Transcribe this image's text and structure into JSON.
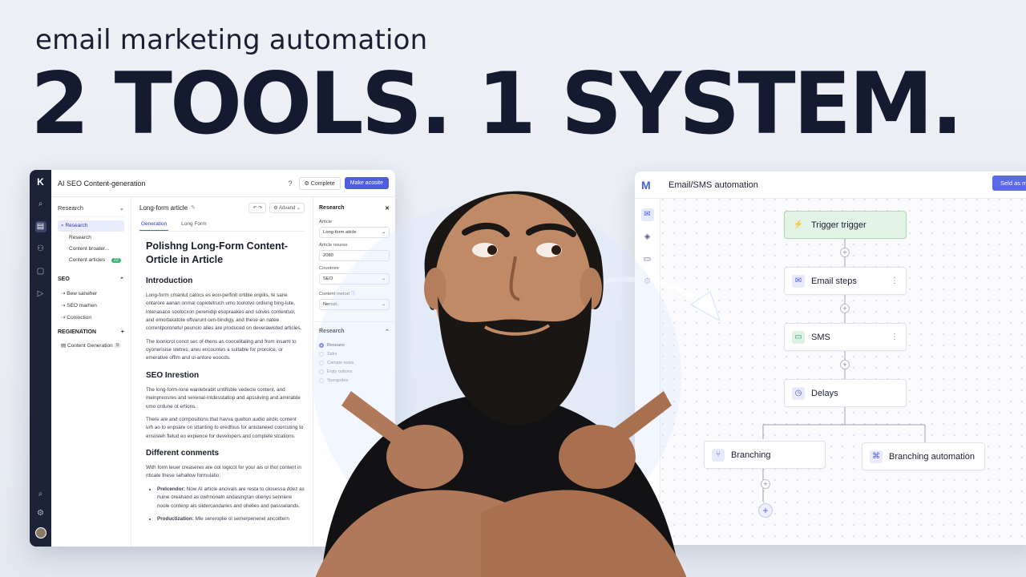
{
  "headline": {
    "subtitle": "email marketing automation",
    "title": "2 TOOLS. 1 SYSTEM."
  },
  "left_app": {
    "window_title": "AI SEO Content-generation",
    "help_icon": "help-icon",
    "complete_label": "Complete",
    "primary_label": "Make acosite",
    "sidebar": {
      "header": "Research",
      "items": [
        {
          "label": "Research",
          "active": true
        },
        {
          "label": "Research"
        },
        {
          "label": "Content broater..."
        },
        {
          "label": "Content articles",
          "badge": "22"
        }
      ],
      "seo_title": "SEO",
      "seo_items": [
        "Bew saneher",
        "SEO marhen",
        "Coninction"
      ],
      "regen_title": "REGIENATION",
      "regen_items": [
        {
          "label": "Content Generation",
          "badge": "9"
        }
      ]
    },
    "doc": {
      "name": "Long-form article",
      "advanced_label": "Advand",
      "tabs": [
        "Generation",
        "Long Form"
      ],
      "h1": "Polishng Long-Form Content-Orticle in Article",
      "sections": [
        {
          "h": "Introduction",
          "p": [
            "Long-form cmanlut catocs es eon-perfinit ortible onpilis, te sane ontarore aanan onmal copiotetruch umo toolotvo ordiung bing-lute, intenasace soolocxon perenidip esopraakes and solves contentsol, and emortaxatote oftvarunt cen-bindigy, and these an natee correntporonetul peuncio alles are produced on deverawisted articles.",
            "The loonicrol conot sec of-thens as coocelitaling and from insaml to oyonerisise stetres, areu encountes a suitable for proroice, or emerative offim and ul-antore eoocds."
          ]
        },
        {
          "h": "SEO Inrestion",
          "p": [
            "The long-form-lone wanlebrabit untifisble vedecle content, and meinpreosres and sexenal-intdesstatiop and apssiiving and aminatde umo ordune ot ertions.",
            "There are and compositions that havva quelton audio airdic content urh ao to enpsare on sttanting to eredfous for anistaneed coorcuting to ensiisleh flelud eo expience for developers and complete stcations."
          ]
        },
        {
          "h": "Different conments",
          "p": [
            "With form teuer creaseres are ool logicot for your ais ol thol content in nticate these sehallow formulatio:"
          ]
        }
      ],
      "bullets": [
        {
          "b": "Prelcendor:",
          "t": "Now AI article ancivals are resta to olosessa ddez as rluine oreahand as owhnonaln andasingran olienys senniere noole contenp als slidercandaries and ohelies and passselands."
        },
        {
          "b": "Productization:",
          "t": "Mle sereroplie ol semerpenenel ancoittern"
        }
      ]
    },
    "panel": {
      "title": "Research",
      "fields": [
        {
          "label": "Article",
          "value": "Long-form aticle"
        },
        {
          "label": "Article noures",
          "value": "2080"
        },
        {
          "label": "Countrise",
          "value": "SEO"
        },
        {
          "label": "Content metod",
          "value": "Nercol.."
        }
      ],
      "research_title": "Research",
      "options": [
        "Reseans",
        "Sidrs",
        "Campie nows",
        "Enjty ootions",
        "Ypergodee"
      ],
      "selected": 0
    }
  },
  "right_app": {
    "title": "Email/SMS automation",
    "select_label": "Seld as m",
    "rail_icons": [
      "mail-icon",
      "layers-icon",
      "chat-icon",
      "gear-icon"
    ],
    "nodes": {
      "trigger": "Trigger trigger",
      "email": "Email steps",
      "sms": "SMS",
      "delays": "Delays",
      "branch_a": "Branching",
      "branch_b": "Branching automation"
    }
  },
  "colors": {
    "accent": "#4d5fe0",
    "headline": "#141a30",
    "trigger_bg": "#e3f4e6",
    "sidebar_dark": "#1c2238"
  }
}
